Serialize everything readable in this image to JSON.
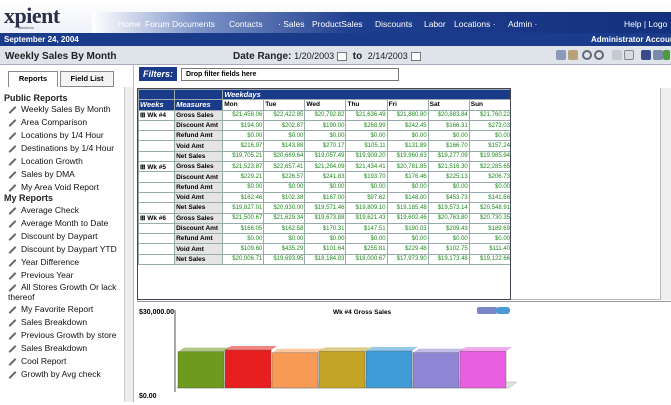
{
  "brand": {
    "name": "xpient",
    "tagline": "solutions"
  },
  "nav": [
    {
      "label": "Home"
    },
    {
      "label": "Forum"
    },
    {
      "label": "Documents"
    },
    {
      "label": "Contacts"
    },
    {
      "label": "· Sales"
    },
    {
      "label": "ProductSales"
    },
    {
      "label": "Discounts"
    },
    {
      "label": "Labor"
    },
    {
      "label": "Locations ·"
    },
    {
      "label": "Admin ·"
    },
    {
      "label": "Help | Logo"
    }
  ],
  "date_bar": {
    "date": "September 24, 2004",
    "account": "Administrator Accoun"
  },
  "page": {
    "title": "Weekly Sales By Month",
    "date_range_label": "Date Range:",
    "date_from": "1/20/2003",
    "date_to_label": "to",
    "date_to": "2/14/2003"
  },
  "sidebar": {
    "tabs": [
      "Reports",
      "Field List"
    ],
    "public_title": "Public Reports",
    "public_reports": [
      "Weekly Sales By Month",
      "Area Comparison",
      "Locations by 1/4 Hour",
      "Destinations by 1/4 Hour",
      "Location Growth",
      "Sales by DMA",
      "My Area Void Report"
    ],
    "my_title": "My Reports",
    "my_reports": [
      "Average Check",
      "Average Month to Date",
      "Discount by Daypart",
      "Discount by Daypart YTD",
      "Year Difference",
      "Previous Year",
      "All Stores Growth Or lack thereof",
      "My Favorite Report",
      "Sales Breakdown",
      "Previous Growth by store",
      "Sales Breakdown",
      "Cool Report",
      "Growth by Avg check"
    ]
  },
  "filters": {
    "label": "Filters:",
    "drop_placeholder": "Drop filter fields here"
  },
  "grid": {
    "weekdays_label": "Weekdays",
    "weeks_label": "Weeks",
    "measures_label": "Measures",
    "days": [
      "Mon",
      "Tue",
      "Wed",
      "Thu",
      "Fri",
      "Sat",
      "Sun"
    ],
    "blocks": [
      {
        "week": "Wk #4",
        "rows": [
          {
            "measure": "Gross Sales",
            "values": [
              "$21,458.06",
              "$22,422.85",
              "$20,792.82",
              "$21,636.49",
              "$21,880.80",
              "$20,883.84",
              "$21,760.22"
            ]
          },
          {
            "measure": "Discount Amt",
            "values": [
              "$194.00",
              "$202.87",
              "$190.00",
              "$268.99",
              "$242.45",
              "$166.31",
              "$273.03"
            ]
          },
          {
            "measure": "Refund Amt",
            "values": [
              "$0.00",
              "$0.00",
              "$0.00",
              "$0.00",
              "$0.00",
              "$0.00",
              "$0.00"
            ]
          },
          {
            "measure": "Void Amt",
            "values": [
              "$216.97",
              "$143.88",
              "$270.17",
              "$105.11",
              "$131.89",
              "$166.70",
              "$157.24"
            ]
          },
          {
            "measure": "Net Sales",
            "values": [
              "$19,705.21",
              "$20,669.64",
              "$19,057.49",
              "$19,909.20",
              "$19,960.63",
              "$19,277.09",
              "$19,985.94"
            ]
          }
        ]
      },
      {
        "week": "Wk #5",
        "rows": [
          {
            "measure": "Gross Sales",
            "values": [
              "$21,523.87",
              "$22,657.41",
              "$21,264.09",
              "$21,434.41",
              "$20,781.85",
              "$21,516.30",
              "$22,285.65"
            ]
          },
          {
            "measure": "Discount Amt",
            "values": [
              "$229.21",
              "$226.57",
              "$241.83",
              "$193.70",
              "$176.46",
              "$225.13",
              "$206.73"
            ]
          },
          {
            "measure": "Refund Amt",
            "values": [
              "$0.00",
              "$0.00",
              "$0.00",
              "$0.00",
              "$0.00",
              "$0.00",
              "$0.00"
            ]
          },
          {
            "measure": "Void Amt",
            "values": [
              "$162.46",
              "$102.38",
              "$167.00",
              "$97.62",
              "$148.00",
              "$453.73",
              "$141.66"
            ]
          },
          {
            "measure": "Net Sales",
            "values": [
              "$19,827.01",
              "$20,930.00",
              "$19,571.46",
              "$19,809.10",
              "$19,185.48",
              "$19,573.14",
              "$20,548.91"
            ]
          }
        ]
      },
      {
        "week": "Wk #6",
        "rows": [
          {
            "measure": "Gross Sales",
            "values": [
              "$21,500.67",
              "$21,629.34",
              "$19,673.88",
              "$19,621.43",
              "$19,602.46",
              "$20,763.80",
              "$20,730.35"
            ]
          },
          {
            "measure": "Discount Amt",
            "values": [
              "$166.05",
              "$162.58",
              "$170.31",
              "$147.51",
              "$190.03",
              "$209.43",
              "$189.69"
            ]
          },
          {
            "measure": "Refund Amt",
            "values": [
              "$0.00",
              "$0.00",
              "$0.00",
              "$0.00",
              "$0.00",
              "$0.00",
              "$0.00"
            ]
          },
          {
            "measure": "Void Amt",
            "values": [
              "$109.60",
              "$435.29",
              "$101.64",
              "$255.81",
              "$229.48",
              "$102.75",
              "$111.40"
            ]
          },
          {
            "measure": "Net Sales",
            "values": [
              "$20,006.71",
              "$19,693.95",
              "$18,184.83",
              "$18,000.67",
              "$17,973.90",
              "$19,173.48",
              "$19,122.66"
            ]
          }
        ]
      }
    ]
  },
  "chart_data": {
    "type": "bar",
    "title": "Wk #4 Gross Sales",
    "categories": [
      "Mon",
      "Tue",
      "Wed",
      "Thu",
      "Fri",
      "Sat",
      "Sun"
    ],
    "values": [
      21458.06,
      22422.85,
      20792.82,
      21636.49,
      21880.8,
      20883.84,
      21760.22
    ],
    "colors": [
      "#6e9a1e",
      "#e81f1f",
      "#f79a55",
      "#c4a424",
      "#3f9ad6",
      "#8f86d6",
      "#e95fe2"
    ],
    "ytick_labels": [
      "$30,000.00",
      "$0.00"
    ],
    "ylim": [
      0,
      30000
    ]
  }
}
